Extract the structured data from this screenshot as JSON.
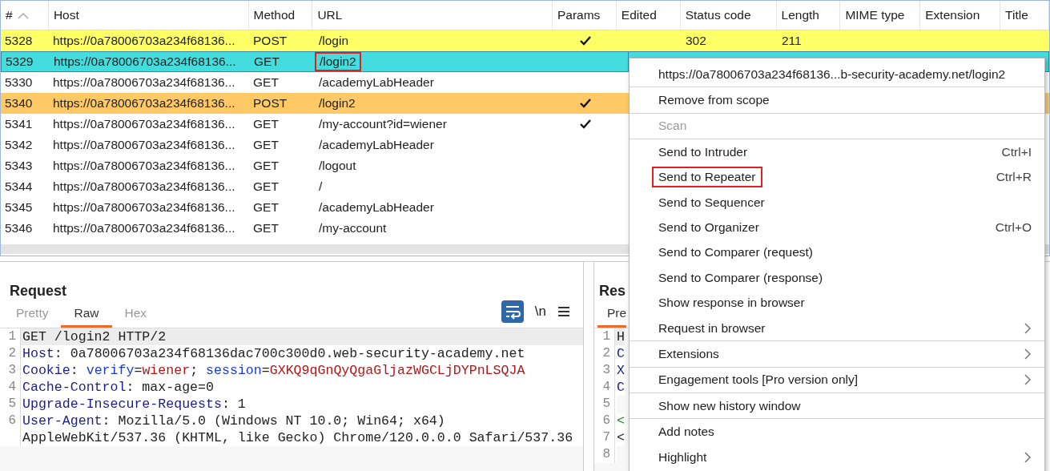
{
  "table": {
    "columns": [
      {
        "label": "#",
        "sorted": true
      },
      {
        "label": "Host",
        "sorted": false
      },
      {
        "label": "Method",
        "sorted": false
      },
      {
        "label": "URL",
        "sorted": false
      },
      {
        "label": "Params",
        "sorted": false
      },
      {
        "label": "Edited",
        "sorted": false
      },
      {
        "label": "Status code",
        "sorted": false
      },
      {
        "label": "Length",
        "sorted": false
      },
      {
        "label": "MIME type",
        "sorted": false
      },
      {
        "label": "Extension",
        "sorted": false
      },
      {
        "label": "Title",
        "sorted": false
      }
    ],
    "rows": [
      {
        "num": "5328",
        "host": "https://0a78006703a234f68136...",
        "method": "POST",
        "url": "/login",
        "params": true,
        "status": "302",
        "length": "211",
        "color": "#ffff66",
        "selected": false,
        "url_outlined": false
      },
      {
        "num": "5329",
        "host": "https://0a78006703a234f68136...",
        "method": "GET",
        "url": "/login2",
        "params": false,
        "selected": true,
        "url_outlined": true
      },
      {
        "num": "5330",
        "host": "https://0a78006703a234f68136...",
        "method": "GET",
        "url": "/academyLabHeader",
        "params": false,
        "selected": false,
        "url_outlined": false
      },
      {
        "num": "5340",
        "host": "https://0a78006703a234f68136...",
        "method": "POST",
        "url": "/login2",
        "params": true,
        "color": "#ffc966",
        "selected": false,
        "url_outlined": false
      },
      {
        "num": "5341",
        "host": "https://0a78006703a234f68136...",
        "method": "GET",
        "url": "/my-account?id=wiener",
        "params": true,
        "selected": false,
        "url_outlined": false
      },
      {
        "num": "5342",
        "host": "https://0a78006703a234f68136...",
        "method": "GET",
        "url": "/academyLabHeader",
        "params": false,
        "selected": false,
        "url_outlined": false
      },
      {
        "num": "5343",
        "host": "https://0a78006703a234f68136...",
        "method": "GET",
        "url": "/logout",
        "params": false,
        "selected": false,
        "url_outlined": false
      },
      {
        "num": "5344",
        "host": "https://0a78006703a234f68136...",
        "method": "GET",
        "url": "/",
        "params": false,
        "selected": false,
        "url_outlined": false
      },
      {
        "num": "5345",
        "host": "https://0a78006703a234f68136...",
        "method": "GET",
        "url": "/academyLabHeader",
        "params": false,
        "selected": false,
        "url_outlined": false
      },
      {
        "num": "5346",
        "host": "https://0a78006703a234f68136...",
        "method": "GET",
        "url": "/my-account",
        "params": false,
        "selected": false,
        "url_outlined": false
      }
    ]
  },
  "request": {
    "title": "Request",
    "tabs": [
      {
        "label": "Pretty",
        "selected": false
      },
      {
        "label": "Raw",
        "selected": true
      },
      {
        "label": "Hex",
        "selected": false
      }
    ],
    "newline_toggle": "\\n",
    "lines": [
      {
        "n": "1",
        "current": true,
        "tokens": [
          {
            "kind": "plain",
            "t": "GET /login2 HTTP/2"
          }
        ]
      },
      {
        "n": "2",
        "current": false,
        "tokens": [
          {
            "kind": "name",
            "t": "Host"
          },
          {
            "kind": "plain",
            "t": ": 0a78006703a234f68136dac700c300d0.web-security-academy.net"
          }
        ]
      },
      {
        "n": "3",
        "current": false,
        "tokens": [
          {
            "kind": "name",
            "t": "Cookie"
          },
          {
            "kind": "plain",
            "t": ": "
          },
          {
            "kind": "param",
            "t": "verify"
          },
          {
            "kind": "plain",
            "t": "="
          },
          {
            "kind": "value",
            "t": "wiener"
          },
          {
            "kind": "plain",
            "t": "; "
          },
          {
            "kind": "param",
            "t": "session"
          },
          {
            "kind": "plain",
            "t": "="
          },
          {
            "kind": "value",
            "t": "GXKQ9qGnQyQgaGljazWGCLjDYPnLSQJA"
          }
        ]
      },
      {
        "n": "4",
        "current": false,
        "tokens": [
          {
            "kind": "name",
            "t": "Cache-Control"
          },
          {
            "kind": "plain",
            "t": ": max-age=0"
          }
        ]
      },
      {
        "n": "5",
        "current": false,
        "tokens": [
          {
            "kind": "name",
            "t": "Upgrade-Insecure-Requests"
          },
          {
            "kind": "plain",
            "t": ": 1"
          }
        ]
      },
      {
        "n": "6",
        "current": false,
        "tokens": [
          {
            "kind": "name",
            "t": "User-Agent"
          },
          {
            "kind": "plain",
            "t": ": Mozilla/5.0 (Windows NT 10.0; Win64; x64) AppleWebKit/537.36 (KHTML, like Gecko) Chrome/120.0.0.0 Safari/537.36"
          }
        ]
      }
    ]
  },
  "response": {
    "title": "Res",
    "tabs": [
      {
        "label": "Pre",
        "selected": true
      }
    ],
    "lines": [
      {
        "n": "1",
        "current": true,
        "tokens": [
          {
            "kind": "plain",
            "t": "H"
          }
        ]
      },
      {
        "n": "2",
        "current": false,
        "tokens": [
          {
            "kind": "name",
            "t": "C"
          }
        ]
      },
      {
        "n": "3",
        "current": false,
        "tokens": [
          {
            "kind": "name",
            "t": "X"
          }
        ]
      },
      {
        "n": "4",
        "current": false,
        "tokens": [
          {
            "kind": "name",
            "t": "C"
          }
        ]
      },
      {
        "n": "5",
        "current": false
      },
      {
        "n": "6",
        "current": false,
        "tokens": [
          {
            "kind": "tag",
            "t": "<"
          }
        ]
      },
      {
        "n": "7",
        "current": false,
        "tokens": [
          {
            "kind": "plain",
            "t": "<"
          }
        ]
      },
      {
        "n": "8",
        "current": false
      }
    ]
  },
  "context_menu": {
    "groups": [
      [
        {
          "label": "https://0a78006703a234f68136...b-security-academy.net/login2",
          "disabled": false,
          "submenu": false,
          "outlined": false
        }
      ],
      [
        {
          "label": "Remove from scope",
          "disabled": false,
          "submenu": false,
          "outlined": false
        }
      ],
      [
        {
          "label": "Scan",
          "disabled": true,
          "submenu": false,
          "outlined": false
        }
      ],
      [
        {
          "label": "Send to Intruder",
          "shortcut": "Ctrl+I",
          "disabled": false,
          "submenu": false,
          "outlined": false
        },
        {
          "label": "Send to Repeater",
          "shortcut": "Ctrl+R",
          "disabled": false,
          "submenu": false,
          "outlined": true
        },
        {
          "label": "Send to Sequencer",
          "disabled": false,
          "submenu": false,
          "outlined": false
        },
        {
          "label": "Send to Organizer",
          "shortcut": "Ctrl+O",
          "disabled": false,
          "submenu": false,
          "outlined": false
        },
        {
          "label": "Send to Comparer (request)",
          "disabled": false,
          "submenu": false,
          "outlined": false
        },
        {
          "label": "Send to Comparer (response)",
          "disabled": false,
          "submenu": false,
          "outlined": false
        },
        {
          "label": "Show response in browser",
          "disabled": false,
          "submenu": false,
          "outlined": false
        },
        {
          "label": "Request in browser",
          "disabled": false,
          "submenu": true,
          "outlined": false
        }
      ],
      [
        {
          "label": "Extensions",
          "disabled": false,
          "submenu": true,
          "outlined": false
        }
      ],
      [
        {
          "label": "Engagement tools [Pro version only]",
          "disabled": false,
          "submenu": true,
          "outlined": false
        }
      ],
      [
        {
          "label": "Show new history window",
          "disabled": false,
          "submenu": false,
          "outlined": false
        }
      ],
      [
        {
          "label": "Add notes",
          "disabled": false,
          "submenu": false,
          "outlined": false
        },
        {
          "label": "Highlight",
          "disabled": false,
          "submenu": true,
          "outlined": false
        }
      ]
    ]
  }
}
